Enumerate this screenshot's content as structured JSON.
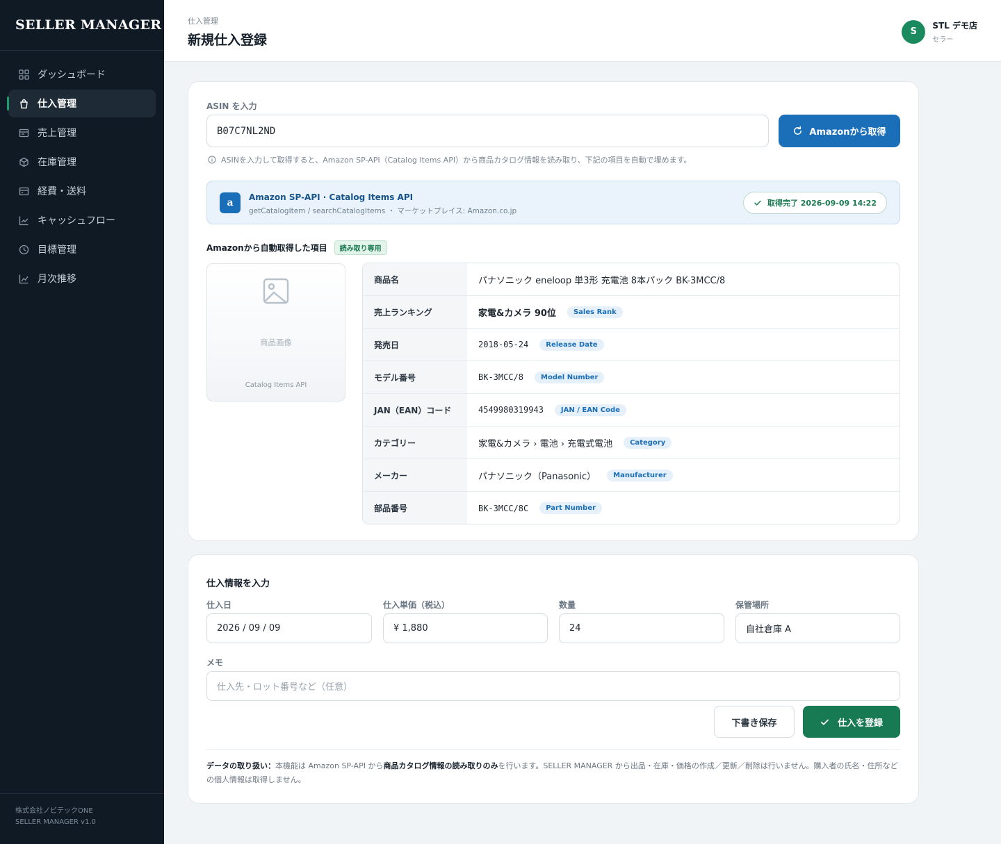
{
  "app": {
    "logo": "SELLER MANAGER"
  },
  "sidebar": {
    "items": [
      {
        "label": "ダッシュボード",
        "icon": "grid-icon",
        "active": false
      },
      {
        "label": "仕入管理",
        "icon": "bag-icon",
        "active": true
      },
      {
        "label": "売上管理",
        "icon": "receipt-icon",
        "active": false
      },
      {
        "label": "在庫管理",
        "icon": "box-icon",
        "active": false
      },
      {
        "label": "経費・送料",
        "icon": "wallet-icon",
        "active": false
      },
      {
        "label": "キャッシュフロー",
        "icon": "trend-icon",
        "active": false
      },
      {
        "label": "目標管理",
        "icon": "clock-icon",
        "active": false
      },
      {
        "label": "月次推移",
        "icon": "chart-icon",
        "active": false
      }
    ],
    "footer_company": "株式会社ノビテックONE",
    "footer_version": "SELLER MANAGER v1.0"
  },
  "header": {
    "breadcrumb": "仕入管理",
    "title": "新規仕入登録",
    "user_initial": "S",
    "user_name": "STL デモ店",
    "user_role": "セラー"
  },
  "asin": {
    "label": "ASIN を入力",
    "value": "B07C7NL2ND",
    "fetch_button": "Amazonから取得",
    "hint": "ASINを入力して取得すると、Amazon SP-API（Catalog Items API）から商品カタログ情報を読み取り、下記の項目を自動で埋めます。"
  },
  "api": {
    "logo": "a",
    "title": "Amazon SP-API · Catalog Items API",
    "subtitle": "getCatalogItem / searchCatalogItems ・ マーケットプレイス: Amazon.co.jp",
    "status": "取得完了 2026-09-09 14:22"
  },
  "auto": {
    "title": "Amazonから自動取得した項目",
    "badge": "読み取り専用",
    "image_label": "商品画像",
    "image_source": "Catalog Items API",
    "rows": [
      {
        "key": "商品名",
        "value": "パナソニック eneloop 単3形 充電池 8本パック BK-3MCC/8",
        "tag": ""
      },
      {
        "key": "売上ランキング",
        "value": "家電&カメラ 90位",
        "tag": "Sales Rank"
      },
      {
        "key": "発売日",
        "value": "2018-05-24",
        "tag": "Release Date"
      },
      {
        "key": "モデル番号",
        "value": "BK-3MCC/8",
        "tag": "Model Number"
      },
      {
        "key": "JAN（EAN）コード",
        "value": "4549980319943",
        "tag": "JAN / EAN Code"
      },
      {
        "key": "カテゴリー",
        "value": "家電&カメラ › 電池 › 充電式電池",
        "tag": "Category"
      },
      {
        "key": "メーカー",
        "value": "パナソニック（Panasonic）",
        "tag": "Manufacturer"
      },
      {
        "key": "部品番号",
        "value": "BK-3MCC/8C",
        "tag": "Part Number"
      }
    ]
  },
  "purchase": {
    "title": "仕入情報を入力",
    "date_label": "仕入日",
    "date_value": "2026 / 09 / 09",
    "price_label": "仕入単価（税込）",
    "price_value": "¥ 1,880",
    "qty_label": "数量",
    "qty_value": "24",
    "location_label": "保管場所",
    "location_value": "自社倉庫 A",
    "memo_label": "メモ",
    "memo_placeholder": "仕入先・ロット番号など（任意）",
    "draft_button": "下書き保存",
    "submit_button": "仕入を登録"
  },
  "note": {
    "lead": "データの取り扱い：",
    "text1": "本機能は Amazon SP-API から",
    "bold": "商品カタログ情報の読み取りのみ",
    "text2": "を行います。SELLER MANAGER から出品・在庫・価格の作成／更新／削除は行いません。購入者の氏名・住所などの個人情報は取得しません。"
  },
  "colors": {
    "sidebar_bg": "#0f1a24",
    "primary_blue": "#1b6fb8",
    "primary_green": "#187a53"
  }
}
